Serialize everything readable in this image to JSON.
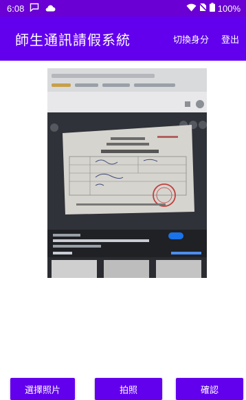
{
  "status_bar": {
    "time": "6:08",
    "battery": "100%",
    "icons": [
      "message-icon",
      "cloud-icon",
      "wifi-icon",
      "no-sim-icon",
      "battery-icon"
    ]
  },
  "app_bar": {
    "title": "師生通訊請假系統",
    "switch_identity": "切換身分",
    "logout": "登出"
  },
  "buttons": {
    "choose_photo": "選擇照片",
    "take_photo": "拍照",
    "confirm": "確認"
  },
  "colors": {
    "primary": "#6200ee",
    "status_bar": "#6a00d4",
    "on_primary": "#ffffff",
    "background": "#ffffff"
  }
}
